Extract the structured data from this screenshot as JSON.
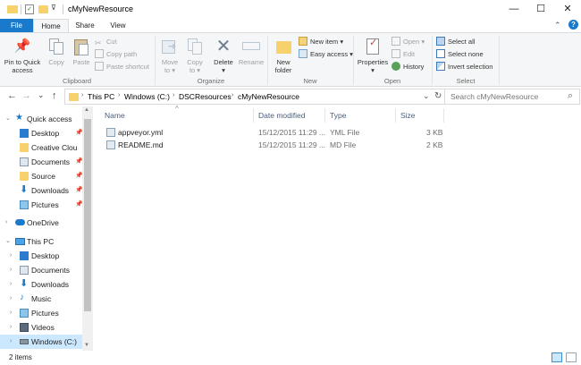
{
  "window": {
    "title": "cMyNewResource",
    "controls": {
      "minimize": "—",
      "maximize": "☐",
      "close": "✕"
    },
    "help": "?",
    "collapse": "⌃"
  },
  "tabs": [
    "File",
    "Home",
    "Share",
    "View"
  ],
  "ribbon": {
    "clipboard": {
      "label": "Clipboard",
      "pin": "Pin to Quick access",
      "pin_l1": "Pin to Quick",
      "pin_l2": "access",
      "copy": "Copy",
      "paste": "Paste",
      "cut": "Cut",
      "copy_path": "Copy path",
      "paste_shortcut": "Paste shortcut"
    },
    "organize": {
      "label": "Organize",
      "move_l1": "Move",
      "move_l2": "to ▾",
      "copy_l1": "Copy",
      "copy_l2": "to ▾",
      "delete_l1": "Delete",
      "delete_l2": "▾",
      "rename": "Rename"
    },
    "new": {
      "label": "New",
      "folder_l1": "New",
      "folder_l2": "folder",
      "new_item": "New item ▾",
      "easy_access": "Easy access ▾"
    },
    "open": {
      "label": "Open",
      "props_l1": "Properties",
      "props_l2": "▾",
      "open": "Open ▾",
      "edit": "Edit",
      "history": "History"
    },
    "select": {
      "label": "Select",
      "select_all": "Select all",
      "select_none": "Select none",
      "invert": "Invert selection"
    }
  },
  "address": {
    "back": "←",
    "forward": "→",
    "recent": "⌄",
    "up": "↑",
    "breadcrumbs": [
      "This PC",
      "Windows (C:)",
      "DSCResources",
      "cMyNewResource"
    ],
    "crumb_sep": "›",
    "dropdown": "⌄",
    "refresh": "↻",
    "search_placeholder": "Search cMyNewResource",
    "search_icon": "⌕"
  },
  "nav": {
    "quick_access": "Quick access",
    "quick_items": [
      "Desktop",
      "Creative Clou",
      "Documents",
      "Source",
      "Downloads",
      "Pictures"
    ],
    "onedrive": "OneDrive",
    "this_pc": "This PC",
    "pc_items": [
      "Desktop",
      "Documents",
      "Downloads",
      "Music",
      "Pictures",
      "Videos",
      "Windows (C:)"
    ]
  },
  "columns": [
    "Name",
    "Date modified",
    "Type",
    "Size"
  ],
  "sort_indicator": "^",
  "files": [
    {
      "name": "appveyor.yml",
      "date": "15/12/2015 11:29 ...",
      "type": "YML File",
      "size": "3 KB"
    },
    {
      "name": "README.md",
      "date": "15/12/2015 11:29 ...",
      "type": "MD File",
      "size": "2 KB"
    }
  ],
  "status": {
    "items": "2 items"
  },
  "colors": {
    "accent": "#1979ca",
    "selection": "#cce8ff",
    "folder": "#f7d26c"
  }
}
